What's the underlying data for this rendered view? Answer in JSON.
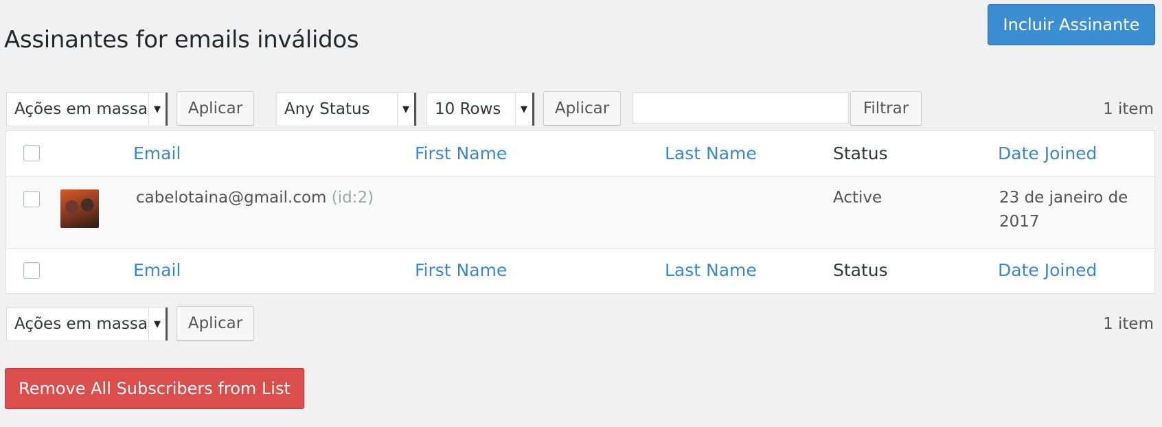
{
  "page": {
    "title": "Assinantes for emails inválidos",
    "add_button": "Incluir Assinante"
  },
  "top_bar": {
    "bulk_actions": "Ações em massa",
    "apply": "Aplicar",
    "status_filter": "Any Status",
    "rows_filter": "10 Rows",
    "apply_filter": "Aplicar",
    "search_value": "",
    "filter_button": "Filtrar",
    "item_count": "1 item"
  },
  "table": {
    "columns": {
      "email": "Email",
      "first_name": "First Name",
      "last_name": "Last Name",
      "status": "Status",
      "date_joined": "Date Joined"
    },
    "rows": [
      {
        "email": "cabelotaina@gmail.com",
        "id": "(id:2)",
        "first_name": "",
        "last_name": "",
        "status": "Active",
        "date_joined_line1": "23 de janeiro de",
        "date_joined_line2": "2017"
      }
    ]
  },
  "bottom_bar": {
    "bulk_actions": "Ações em massa",
    "apply": "Aplicar",
    "item_count": "1 item"
  },
  "danger_button": "Remove All Subscribers from List",
  "colors": {
    "primary": "#3b8ed2",
    "danger": "#dc4e4b",
    "link": "#3b87c8"
  }
}
